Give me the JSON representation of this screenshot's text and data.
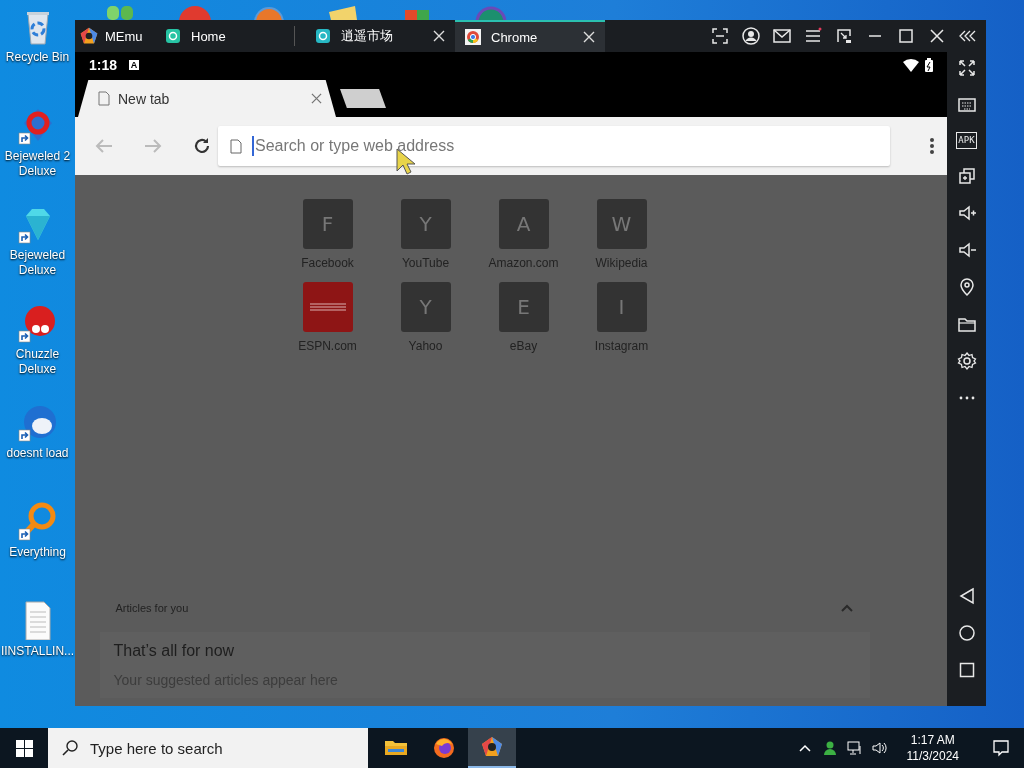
{
  "desktop": {
    "icons": [
      {
        "label": "Recycle Bin",
        "kind": "recycle",
        "shortcut": false
      },
      {
        "label": "Bejeweled 2 Deluxe",
        "kind": "gem2",
        "shortcut": true
      },
      {
        "label": "Bejeweled Deluxe",
        "kind": "gem",
        "shortcut": true
      },
      {
        "label": "Chuzzle Deluxe",
        "kind": "fuzzball",
        "shortcut": true
      },
      {
        "label": "doesnt load",
        "kind": "mailbird",
        "shortcut": true
      },
      {
        "label": "Everything",
        "kind": "magnifier",
        "shortcut": true
      },
      {
        "label": "IINSTALLIN...",
        "kind": "document",
        "shortcut": false
      }
    ]
  },
  "window": {
    "brand": "MEmu",
    "tabs": [
      {
        "label": "Home",
        "kind": "home",
        "selected": false,
        "closable": false
      },
      {
        "label": "逍遥市场",
        "kind": "market",
        "selected": false,
        "closable": true
      },
      {
        "label": "Chrome",
        "kind": "chrome",
        "selected": true,
        "closable": true
      }
    ]
  },
  "android": {
    "time": "1:18",
    "notification": "A",
    "browser": {
      "tab": {
        "label": "New tab"
      },
      "address": {
        "placeholder": "Search or type web address"
      },
      "tiles": [
        {
          "kind": "letter",
          "letter": "F",
          "label": "Facebook"
        },
        {
          "kind": "letter",
          "letter": "Y",
          "label": "YouTube"
        },
        {
          "kind": "letter",
          "letter": "A",
          "label": "Amazon.com"
        },
        {
          "kind": "letter",
          "letter": "W",
          "label": "Wikipedia"
        },
        {
          "kind": "logo",
          "label": "ESPN.com"
        },
        {
          "kind": "letter",
          "letter": "Y",
          "label": "Yahoo"
        },
        {
          "kind": "letter",
          "letter": "E",
          "label": "eBay"
        },
        {
          "kind": "letter",
          "letter": "I",
          "label": "Instagram"
        }
      ],
      "articles": {
        "header": "Articles for you",
        "expanded": true,
        "title": "That’s all for now",
        "subtitle": "Your suggested articles appear here"
      }
    }
  },
  "sidebar": {
    "apk_label": "APK"
  },
  "taskbar": {
    "search_placeholder": "Type here to search",
    "apps": [
      {
        "kind": "explorer",
        "selected": false
      },
      {
        "kind": "firefox",
        "selected": false
      },
      {
        "kind": "memu",
        "selected": true
      }
    ],
    "time": "1:17 AM",
    "date": "11/3/2024"
  }
}
